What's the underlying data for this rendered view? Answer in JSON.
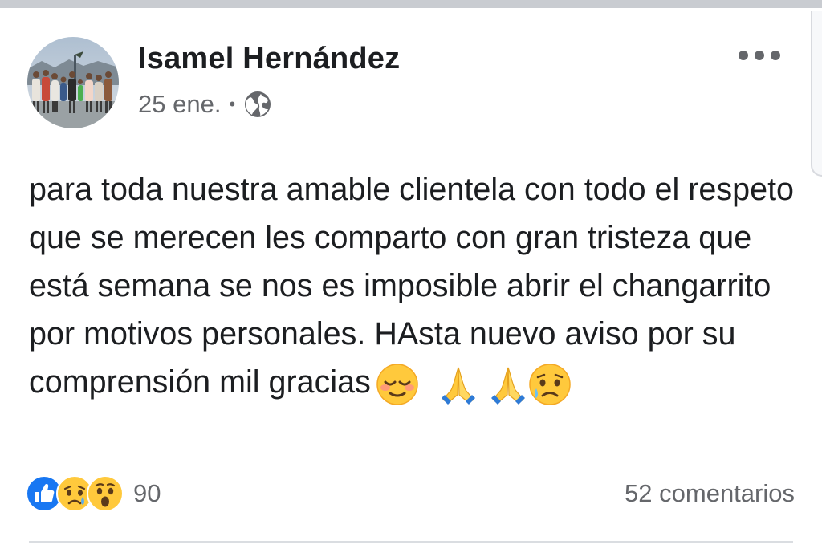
{
  "post": {
    "author": "Isamel Hernández",
    "date": "25 ene.",
    "separator": "•",
    "privacy_icon": "globe-icon",
    "more_icon": "more-options-icon",
    "text": "para toda nuestra amable clientela con todo el respeto que se merecen les comparto con gran tristeza que está semana se nos es imposible abrir el changarrito por motivos personales. HAsta nuevo aviso  por su comprensión mil gracias",
    "emojis": [
      "relieved-face-icon",
      "folded-hands-icon",
      "folded-hands-icon",
      "sad-tear-face-icon"
    ]
  },
  "footer": {
    "reaction_icons": [
      "like-reaction-icon",
      "sad-reaction-icon",
      "wow-reaction-icon"
    ],
    "reaction_count": "90",
    "comments_label": "52 comentarios"
  },
  "colors": {
    "text": "#1c1e21",
    "muted": "#65676b",
    "like_blue": "#1877f2",
    "emoji_yellow": "#ffc93c"
  }
}
